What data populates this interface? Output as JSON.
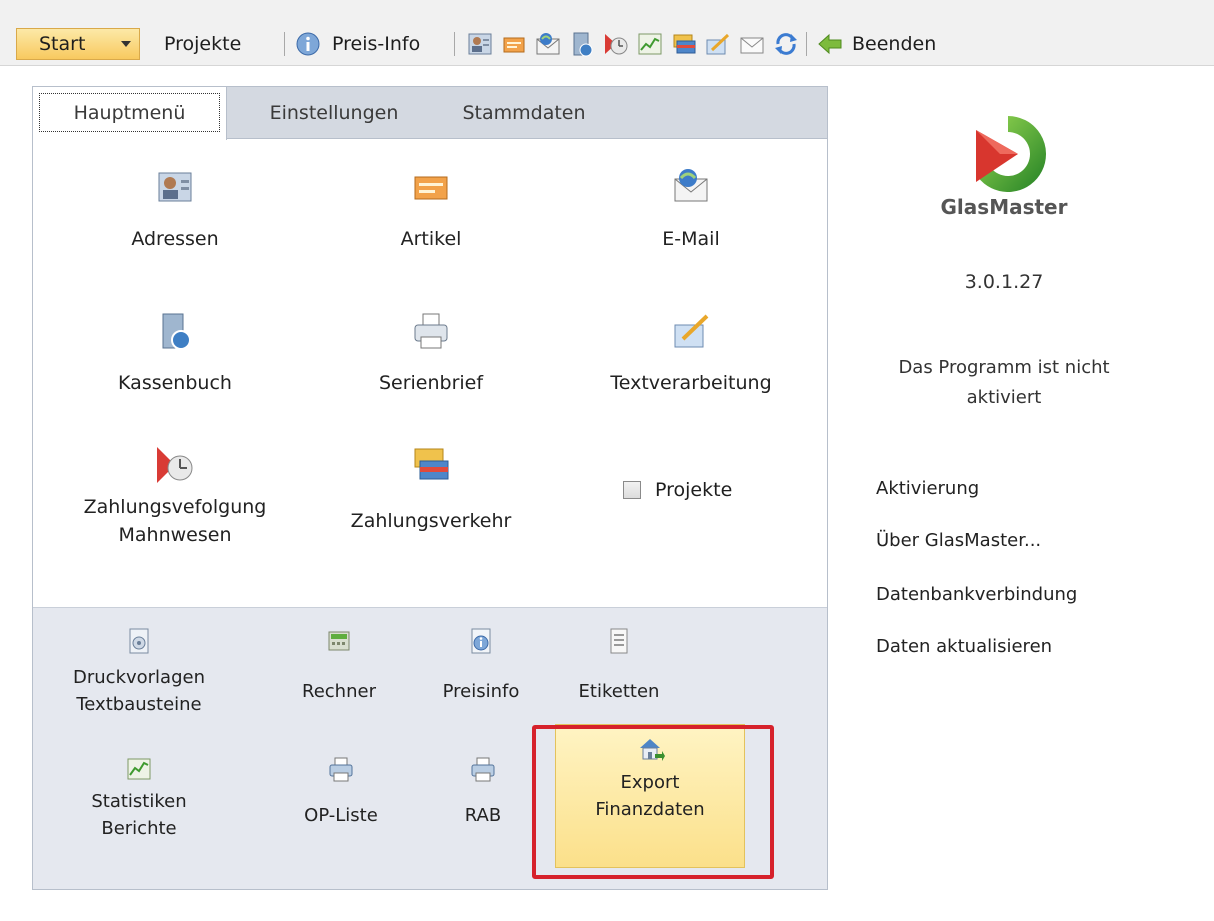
{
  "toolbar": {
    "start_label": "Start",
    "projects_label": "Projekte",
    "preisinfo_label": "Preis-Info",
    "exit_label": "Beenden"
  },
  "tabs": [
    {
      "label": "Hauptmenü"
    },
    {
      "label": "Einstellungen"
    },
    {
      "label": "Stammdaten"
    }
  ],
  "main_tiles": [
    {
      "label": "Adressen"
    },
    {
      "label": "Artikel"
    },
    {
      "label": "E-Mail"
    },
    {
      "label": "Kassenbuch"
    },
    {
      "label": "Serienbrief"
    },
    {
      "label": "Textverarbeitung"
    },
    {
      "label_line1": "Zahlungsvefolgung",
      "label_line2": "Mahnwesen"
    },
    {
      "label": "Zahlungsverkehr"
    }
  ],
  "projects_checkbox": {
    "label": "Projekte",
    "checked": false
  },
  "lower_tiles": [
    {
      "label_line1": "Druckvorlagen",
      "label_line2": "Textbausteine"
    },
    {
      "label": "Rechner"
    },
    {
      "label": "Preisinfo"
    },
    {
      "label": "Etiketten"
    },
    {
      "label_line1": "Statistiken",
      "label_line2": "Berichte"
    },
    {
      "label": "OP-Liste"
    },
    {
      "label": "RAB"
    },
    {
      "label_line1": "Export",
      "label_line2": "Finanzdaten"
    }
  ],
  "info": {
    "app_name": "GlasMaster",
    "version": "3.0.1.27",
    "activation_line1": "Das Programm ist nicht",
    "activation_line2": "aktiviert",
    "links": [
      "Aktivierung",
      "Über GlasMaster...",
      "Datenbankverbindung",
      "Daten aktualisieren"
    ]
  },
  "colors": {
    "highlight": "#d6212b",
    "selected_tile": "#fbe08a",
    "tab_strip": "#d4d9e1",
    "lower_panel": "#e5e8ef"
  }
}
